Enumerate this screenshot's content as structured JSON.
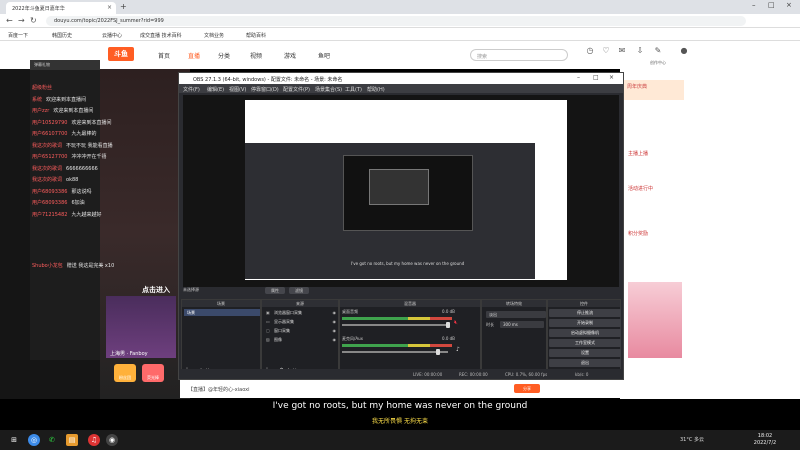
{
  "browser": {
    "tab_title": "2022年斗鱼夏日嘉年华",
    "url": "douyu.com/topic/2022FSJ_summer?rid=999",
    "bookmarks": [
      "百度一下",
      "韩国历史",
      "云播中心",
      "成交直播 技术百科",
      "文档业务",
      "帮助百科"
    ]
  },
  "site": {
    "logo": "斗鱼",
    "nav": [
      "首页",
      "直播",
      "分类",
      "视频",
      "游戏",
      "鱼吧"
    ],
    "search_placeholder": "搜索",
    "header_labels": [
      "",
      "",
      "",
      "",
      "创作中心"
    ]
  },
  "chat": {
    "header": "弹幕礼物",
    "lines": [
      {
        "user": "超级粉丝",
        "msg": ""
      },
      {
        "user": "系统",
        "msg": "欢迎来到本直播间"
      },
      {
        "user": "用户zzr",
        "msg": "欢迎来到本直播间"
      },
      {
        "user": "用户10529790",
        "msg": "欢迎来到本直播间"
      },
      {
        "user": "用户66107700",
        "msg": "九九最棒的"
      },
      {
        "user": "我这次的歌词",
        "msg": "不玩不玩 我能看直播"
      },
      {
        "user": "用户65127700",
        "msg": "冲冲冲开在千禧"
      },
      {
        "user": "我这次的歌词",
        "msg": "6666666666"
      },
      {
        "user": "我这次的歌词",
        "msg": "ok88"
      },
      {
        "user": "用户68093386",
        "msg": "那这说吗"
      },
      {
        "user": "用户68093386",
        "msg": "6加油"
      },
      {
        "user": "用户71215482",
        "msg": "九九越来越好"
      },
      {
        "user": "Shubo小龙包",
        "msg": "赠送 我这是完美 x10"
      }
    ],
    "click_hint": "点击进入",
    "streamer": "上海男 · Fanboy",
    "gifts": [
      "粉丝团",
      "荧光棒"
    ]
  },
  "obs": {
    "title": "OBS 27.1.3 (64-bit, windows) - 配置文件: 未命名 - 场景: 未命名",
    "menu": [
      "文件(F)",
      "编辑(E)",
      "视图(V)",
      "停靠窗口(D)",
      "配置文件(P)",
      "场景集合(S)",
      "工具(T)",
      "帮助(H)"
    ],
    "preview_subtitle": "I've got no roots, but my home was never on the ground",
    "scene_label": "未选择源",
    "preview_buttons": [
      "属性",
      "滤镜"
    ],
    "docks": {
      "scenes": "场景",
      "sources": "来源",
      "mixer": "混音器",
      "transitions": "转场特效",
      "controls": "控件"
    },
    "scene_items": [
      "场景"
    ],
    "sources": [
      "浏览器窗口采集",
      "显示器采集",
      "窗口采集",
      "图像"
    ],
    "mixer": [
      {
        "name": "桌面音频",
        "level": "0.0 dB"
      },
      {
        "name": "麦克风/Aux",
        "level": "0.0 dB"
      }
    ],
    "transition": "淡出",
    "duration_label": "时长",
    "duration": "300 ms",
    "controls": [
      "停止推流",
      "开始录制",
      "启动虚拟摄像机",
      "工作室模式",
      "设置",
      "退出"
    ],
    "status": [
      "LIVE: 00:00:00",
      "REC: 00:00:00",
      "CPU: 0.7%, 60.00 fps",
      "kb/s: 0"
    ]
  },
  "page_bottom": {
    "room": "【直播】@年轻的心-xiaoxi",
    "share": "分享"
  },
  "subtitles": {
    "en": "I've got no roots, but my home was never on the ground",
    "cn": "我无所畏惧 无拘无束"
  },
  "taskbar": {
    "weather": "31°C 多云",
    "time": "18:02",
    "date": "2022/7/2"
  },
  "right_panel": {
    "lines": [
      "周年庆典",
      "主播上播",
      "活动进行中",
      "积分奖励"
    ]
  }
}
